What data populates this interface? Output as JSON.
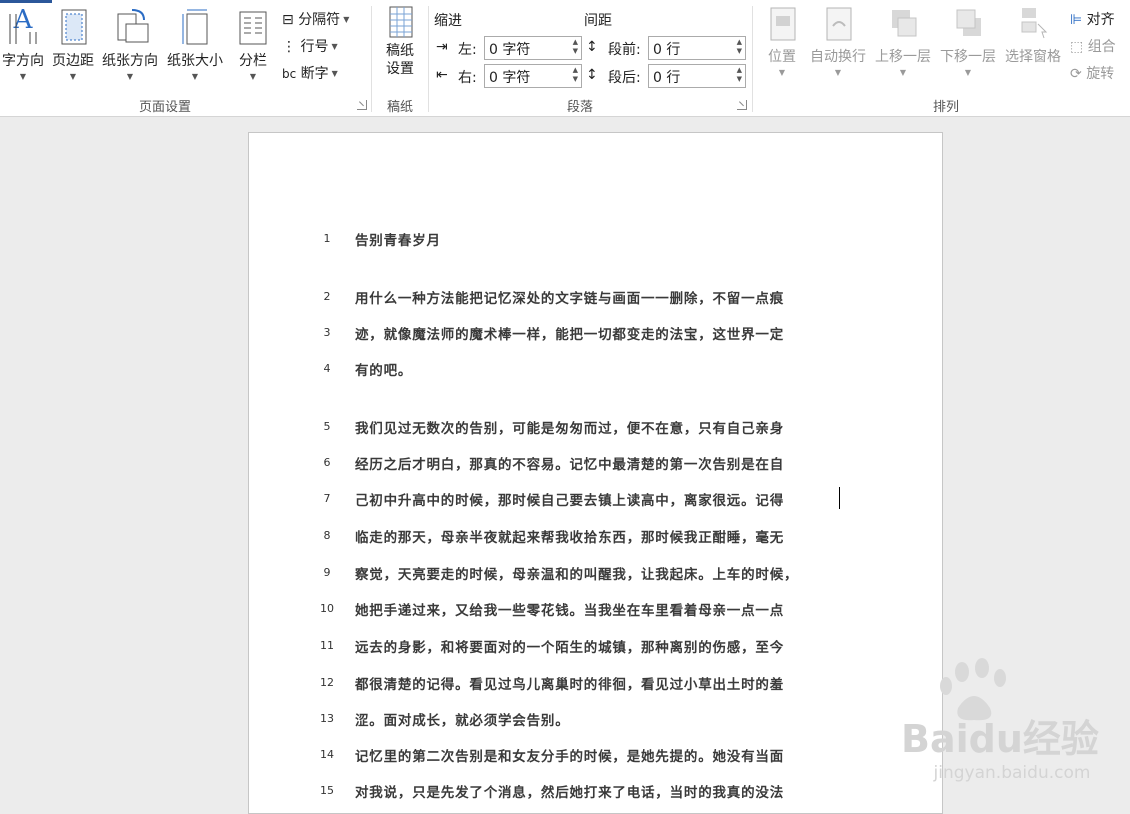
{
  "ribbon": {
    "page_setup": {
      "text_direction": "字方向",
      "margins": "页边距",
      "orientation": "纸张方向",
      "size": "纸张大小",
      "columns": "分栏",
      "breaks": "分隔符",
      "line_numbers": "行号",
      "hyphenation": "断字",
      "group_label": "页面设置"
    },
    "manuscript": {
      "setup_line1": "稿纸",
      "setup_line2": "设置",
      "group_label": "稿纸"
    },
    "paragraph": {
      "indent_title": "缩进",
      "spacing_title": "间距",
      "left_label": "左:",
      "left_value": "0 字符",
      "right_label": "右:",
      "right_value": "0 字符",
      "before_label": "段前:",
      "before_value": "0 行",
      "after_label": "段后:",
      "after_value": "0 行",
      "group_label": "段落"
    },
    "arrange": {
      "position": "位置",
      "wrap_text": "自动换行",
      "bring_forward": "上移一层",
      "send_backward": "下移一层",
      "selection_pane": "选择窗格",
      "align": "对齐",
      "group": "组合",
      "rotate": "旋转",
      "group_label": "排列"
    }
  },
  "document": {
    "lines": [
      {
        "num": "1",
        "text": "告别青春岁月"
      },
      {
        "num": "2",
        "text": "用什么一种方法能把记忆深处的文字链与画面一一删除，不留一点痕"
      },
      {
        "num": "3",
        "text": "迹，就像魔法师的魔术棒一样，能把一切都变走的法宝，这世界一定"
      },
      {
        "num": "4",
        "text": "有的吧。"
      },
      {
        "num": "5",
        "text": "我们见过无数次的告别，可能是匆匆而过，便不在意，只有自己亲身"
      },
      {
        "num": "6",
        "text": "经历之后才明白，那真的不容易。记忆中最清楚的第一次告别是在自"
      },
      {
        "num": "7",
        "text": "己初中升高中的时候，那时候自己要去镇上读高中，离家很远。记得"
      },
      {
        "num": "8",
        "text": "临走的那天，母亲半夜就起来帮我收拾东西，那时候我正酣睡，毫无"
      },
      {
        "num": "9",
        "text": "察觉，天亮要走的时候，母亲温和的叫醒我，让我起床。上车的时候，"
      },
      {
        "num": "10",
        "text": "她把手递过来，又给我一些零花钱。当我坐在车里看着母亲一点一点"
      },
      {
        "num": "11",
        "text": "远去的身影，和将要面对的一个陌生的城镇，那种离别的伤感，至今"
      },
      {
        "num": "12",
        "text": "都很清楚的记得。看见过鸟儿离巢时的徘徊，看见过小草出土时的羞"
      },
      {
        "num": "13",
        "text": "涩。面对成长，就必须学会告别。"
      },
      {
        "num": "14",
        "text": "记忆里的第二次告别是和女友分手的时候，是她先提的。她没有当面"
      },
      {
        "num": "15",
        "text": "对我说，只是先发了个消息，然后她打来了电话，当时的我真的没法"
      }
    ]
  },
  "watermark": {
    "brand": "Baidu经验",
    "url": "jingyan.baidu.com"
  }
}
